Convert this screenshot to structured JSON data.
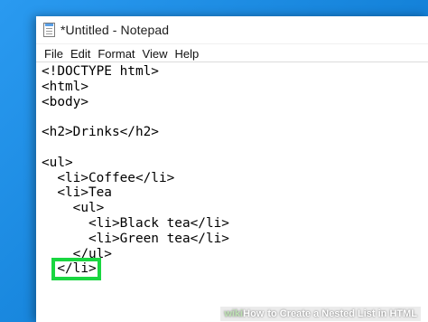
{
  "window": {
    "title": "*Untitled - Notepad"
  },
  "menu": [
    "File",
    "Edit",
    "Format",
    "View",
    "Help"
  ],
  "editor": {
    "lines": [
      "<!DOCTYPE html>",
      "<html>",
      "<body>",
      "",
      "<h2>Drinks</h2>",
      "",
      "<ul>",
      "  <li>Coffee</li>",
      "  <li>Tea",
      "    <ul>",
      "      <li>Black tea</li>",
      "      <li>Green tea</li>",
      "    </ul>"
    ],
    "highlighted_line": "</li>",
    "highlighted_indent": "  "
  },
  "watermark": {
    "logo_wiki": "wiki",
    "logo_how": "How",
    "text": "to Create a Nested List in HTML"
  },
  "colors": {
    "highlight": "#19d640",
    "desktop": "#1e8be0"
  }
}
